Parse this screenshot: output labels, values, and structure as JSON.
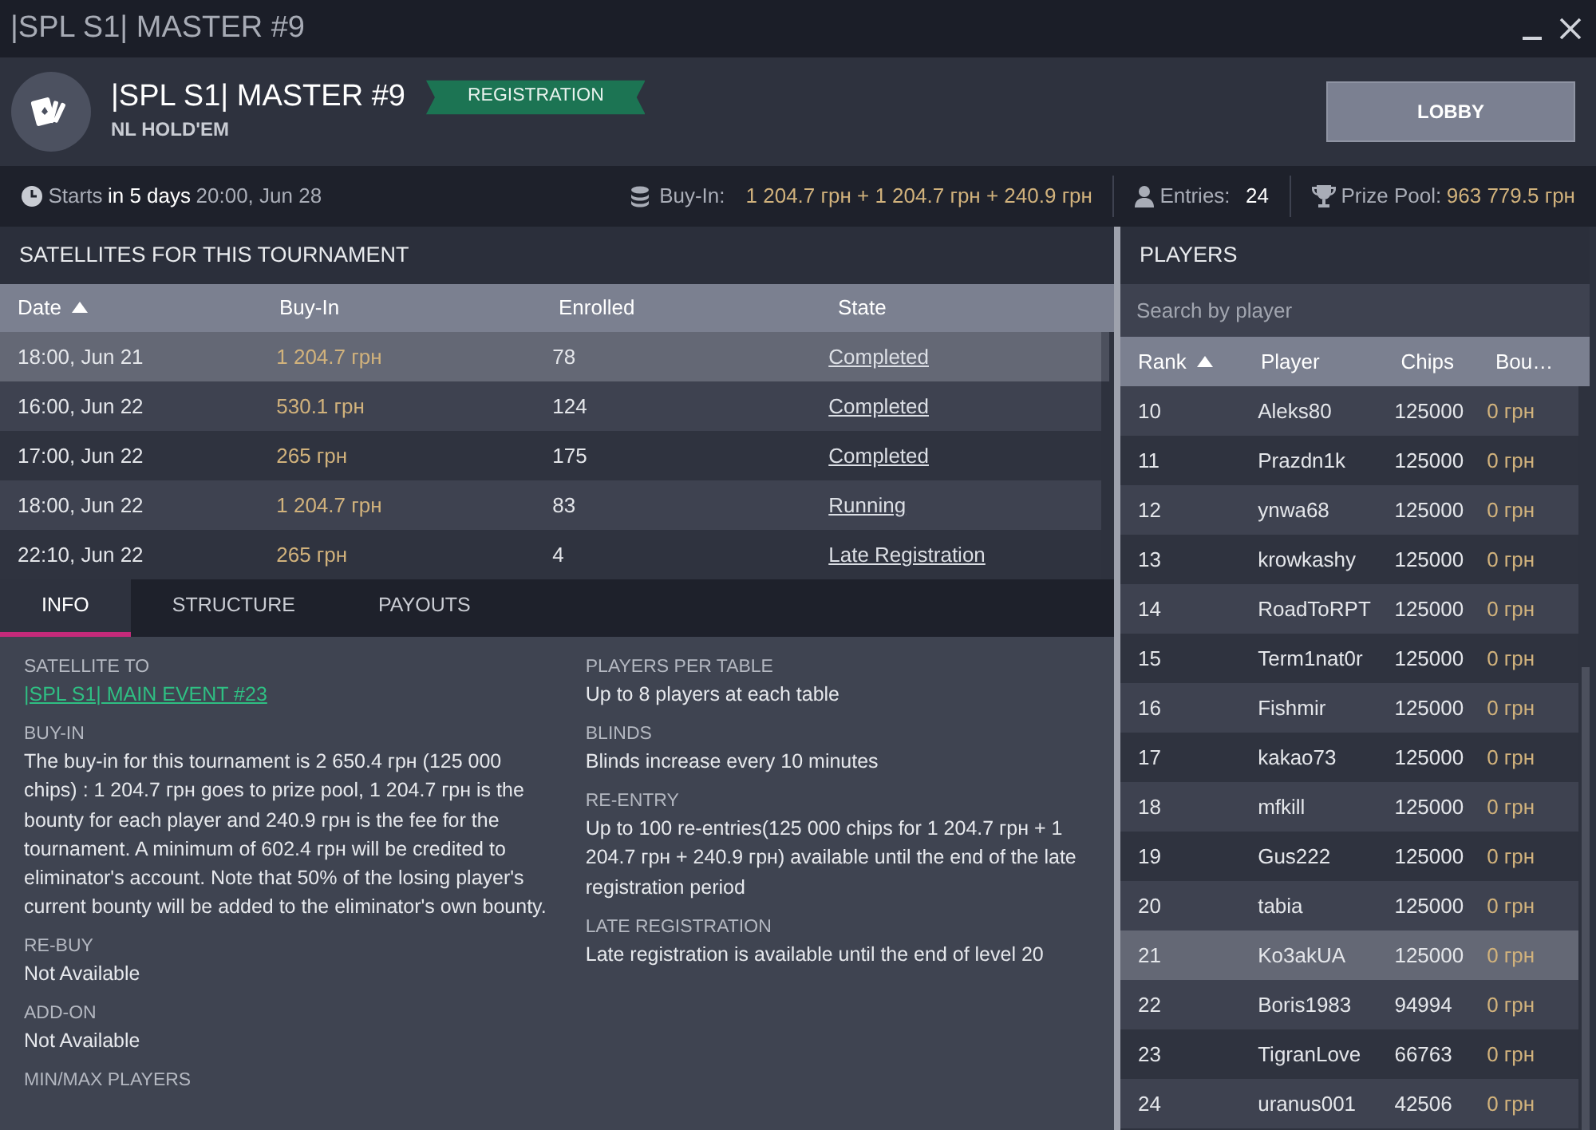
{
  "window": {
    "title": "|SPL S1| MASTER  #9"
  },
  "header": {
    "name": "|SPL S1| MASTER  #9",
    "status": "REGISTRATION",
    "game": "NL HOLD'EM",
    "button": "LOBBY"
  },
  "info_bar": {
    "starts_label": "Starts",
    "starts_relative": "in 5 days",
    "starts_date": "20:00, Jun 28",
    "buyin_label": "Buy-In:",
    "buyin_value": "1 204.7 грн + 1 204.7 грн + 240.9 грн",
    "entries_label": "Entries:",
    "entries_value": "24",
    "prize_label": "Prize Pool:",
    "prize_value": "963 779.5 грн"
  },
  "satellites": {
    "title": "SATELLITES FOR THIS TOURNAMENT",
    "columns": [
      {
        "label": "Date",
        "sorted": true
      },
      {
        "label": "Buy-In",
        "sorted": false
      },
      {
        "label": "Enrolled",
        "sorted": false
      },
      {
        "label": "State",
        "sorted": false
      }
    ],
    "rows": [
      {
        "date": "18:00, Jun 21",
        "buyin": "1 204.7 грн",
        "enrolled": "78",
        "state": "Completed",
        "selected": true
      },
      {
        "date": "16:00, Jun 22",
        "buyin": "530.1 грн",
        "enrolled": "124",
        "state": "Completed",
        "selected": false
      },
      {
        "date": "17:00, Jun 22",
        "buyin": "265 грн",
        "enrolled": "175",
        "state": "Completed",
        "selected": false
      },
      {
        "date": "18:00, Jun 22",
        "buyin": "1 204.7 грн",
        "enrolled": "83",
        "state": "Running",
        "selected": false
      },
      {
        "date": "22:10, Jun 22",
        "buyin": "265 грн",
        "enrolled": "4",
        "state": "Late Registration",
        "selected": false
      }
    ]
  },
  "tabs": [
    {
      "label": "INFO",
      "selected": true
    },
    {
      "label": "STRUCTURE",
      "selected": false
    },
    {
      "label": "PAYOUTS",
      "selected": false
    }
  ],
  "info": {
    "columns": [
      [
        {
          "label": "SATELLITE TO",
          "value": "|SPL S1| MAIN EVENT #23",
          "kind": "link"
        },
        {
          "label": "BUY-IN",
          "value": "The buy-in for this tournament is 2 650.4 грн (125 000 chips) : 1 204.7 грн goes to prize pool, 1 204.7 грн is the bounty for each player and 240.9 грн is the fee for the tournament. A minimum of 602.4 грн will be credited to eliminator's account. Note that 50% of the losing player's current bounty will be added to the eliminator's own bounty.",
          "kind": "text"
        },
        {
          "label": "RE-BUY",
          "value": "Not Available",
          "kind": "text"
        },
        {
          "label": "ADD-ON",
          "value": "Not Available",
          "kind": "text"
        },
        {
          "label": "MIN/MAX PLAYERS",
          "kind": "text"
        }
      ],
      [
        {
          "label": "PLAYERS PER TABLE",
          "value": "Up to 8 players at each table",
          "kind": "text"
        },
        {
          "label": "BLINDS",
          "value": "Blinds increase every 10 minutes",
          "kind": "text"
        },
        {
          "label": "RE-ENTRY",
          "value": "Up to 100 re-entries(125 000 chips for 1 204.7 грн + 1 204.7 грн + 240.9 грн) available until the end of the late registration period",
          "kind": "text"
        },
        {
          "label": "LATE REGISTRATION",
          "value": "Late registration is available until the end of level 20",
          "kind": "text"
        }
      ]
    ]
  },
  "players": {
    "title": "PLAYERS",
    "search": {
      "placeholder": "Search by player"
    },
    "columns": [
      {
        "label": "Rank",
        "sorted": true
      },
      {
        "label": "Player",
        "sorted": false
      },
      {
        "label": "Chips",
        "sorted": false
      },
      {
        "label": "Bou…",
        "sorted": false
      }
    ],
    "rows": [
      {
        "rank": "10",
        "player": "Aleks80",
        "chips": "125000",
        "bounty": "0 грн",
        "selected": false
      },
      {
        "rank": "11",
        "player": "Prazdn1k",
        "chips": "125000",
        "bounty": "0 грн",
        "selected": false
      },
      {
        "rank": "12",
        "player": "ynwa68",
        "chips": "125000",
        "bounty": "0 грн",
        "selected": false
      },
      {
        "rank": "13",
        "player": "krowkashy",
        "chips": "125000",
        "bounty": "0 грн",
        "selected": false
      },
      {
        "rank": "14",
        "player": "RoadToRPT",
        "chips": "125000",
        "bounty": "0 грн",
        "selected": false
      },
      {
        "rank": "15",
        "player": "Term1nat0r",
        "chips": "125000",
        "bounty": "0 грн",
        "selected": false
      },
      {
        "rank": "16",
        "player": "Fishmir",
        "chips": "125000",
        "bounty": "0 грн",
        "selected": false
      },
      {
        "rank": "17",
        "player": "kakao73",
        "chips": "125000",
        "bounty": "0 грн",
        "selected": false
      },
      {
        "rank": "18",
        "player": "mfkill",
        "chips": "125000",
        "bounty": "0 грн",
        "selected": false
      },
      {
        "rank": "19",
        "player": "Gus222",
        "chips": "125000",
        "bounty": "0 грн",
        "selected": false
      },
      {
        "rank": "20",
        "player": "tabia",
        "chips": "125000",
        "bounty": "0 грн",
        "selected": false
      },
      {
        "rank": "21",
        "player": "Ko3akUA",
        "chips": "125000",
        "bounty": "0 грн",
        "selected": true
      },
      {
        "rank": "22",
        "player": "Boris1983",
        "chips": "94994",
        "bounty": "0 грн",
        "selected": false
      },
      {
        "rank": "23",
        "player": "TigranLove",
        "chips": "66763",
        "bounty": "0 грн",
        "selected": false
      },
      {
        "rank": "24",
        "player": "uranus001",
        "chips": "42506",
        "bounty": "0 грн",
        "selected": false
      }
    ]
  }
}
